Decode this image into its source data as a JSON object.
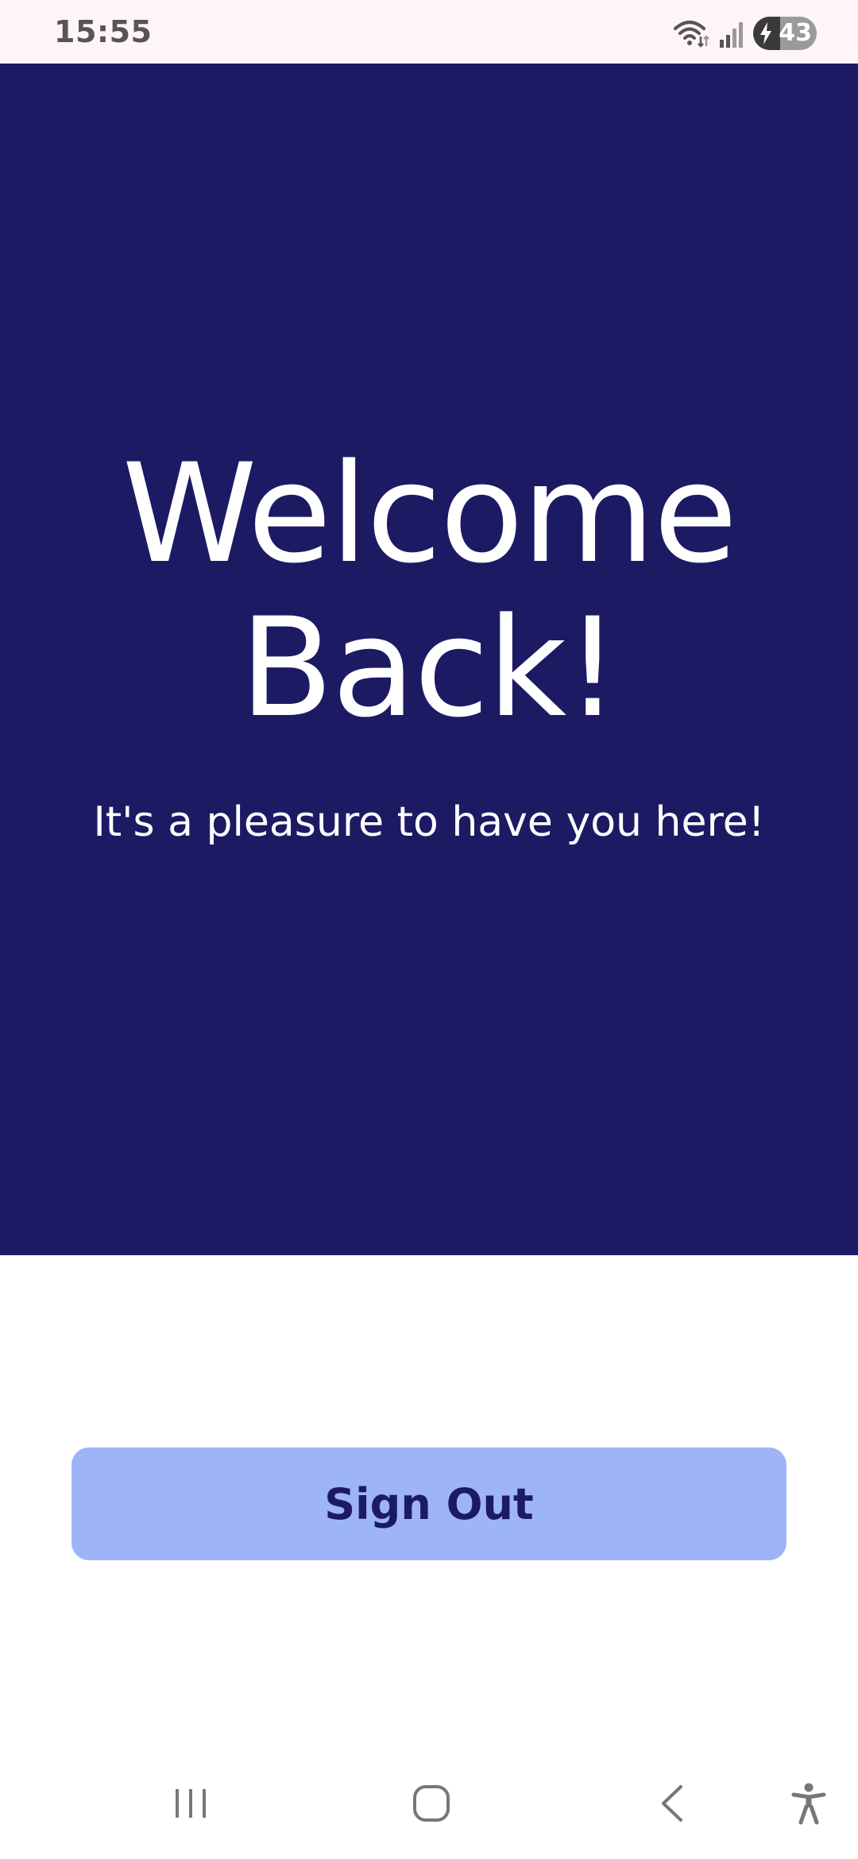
{
  "status_bar": {
    "time": "15:55",
    "battery_level": "43",
    "battery_fraction": 0.43,
    "icons": [
      "wifi-icon",
      "signal-icon",
      "battery-charging-icon"
    ]
  },
  "hero": {
    "title_line1": "Welcome",
    "title_line2": "Back!",
    "subtitle": "It's a pleasure to have you here!",
    "background_color": "#1d1a64"
  },
  "actions": {
    "sign_out_label": "Sign Out",
    "button_color": "#9db5f6",
    "button_text_color": "#1d1a64"
  },
  "nav_bar": {
    "buttons": [
      "recents-icon",
      "home-icon",
      "back-icon",
      "accessibility-icon"
    ]
  }
}
